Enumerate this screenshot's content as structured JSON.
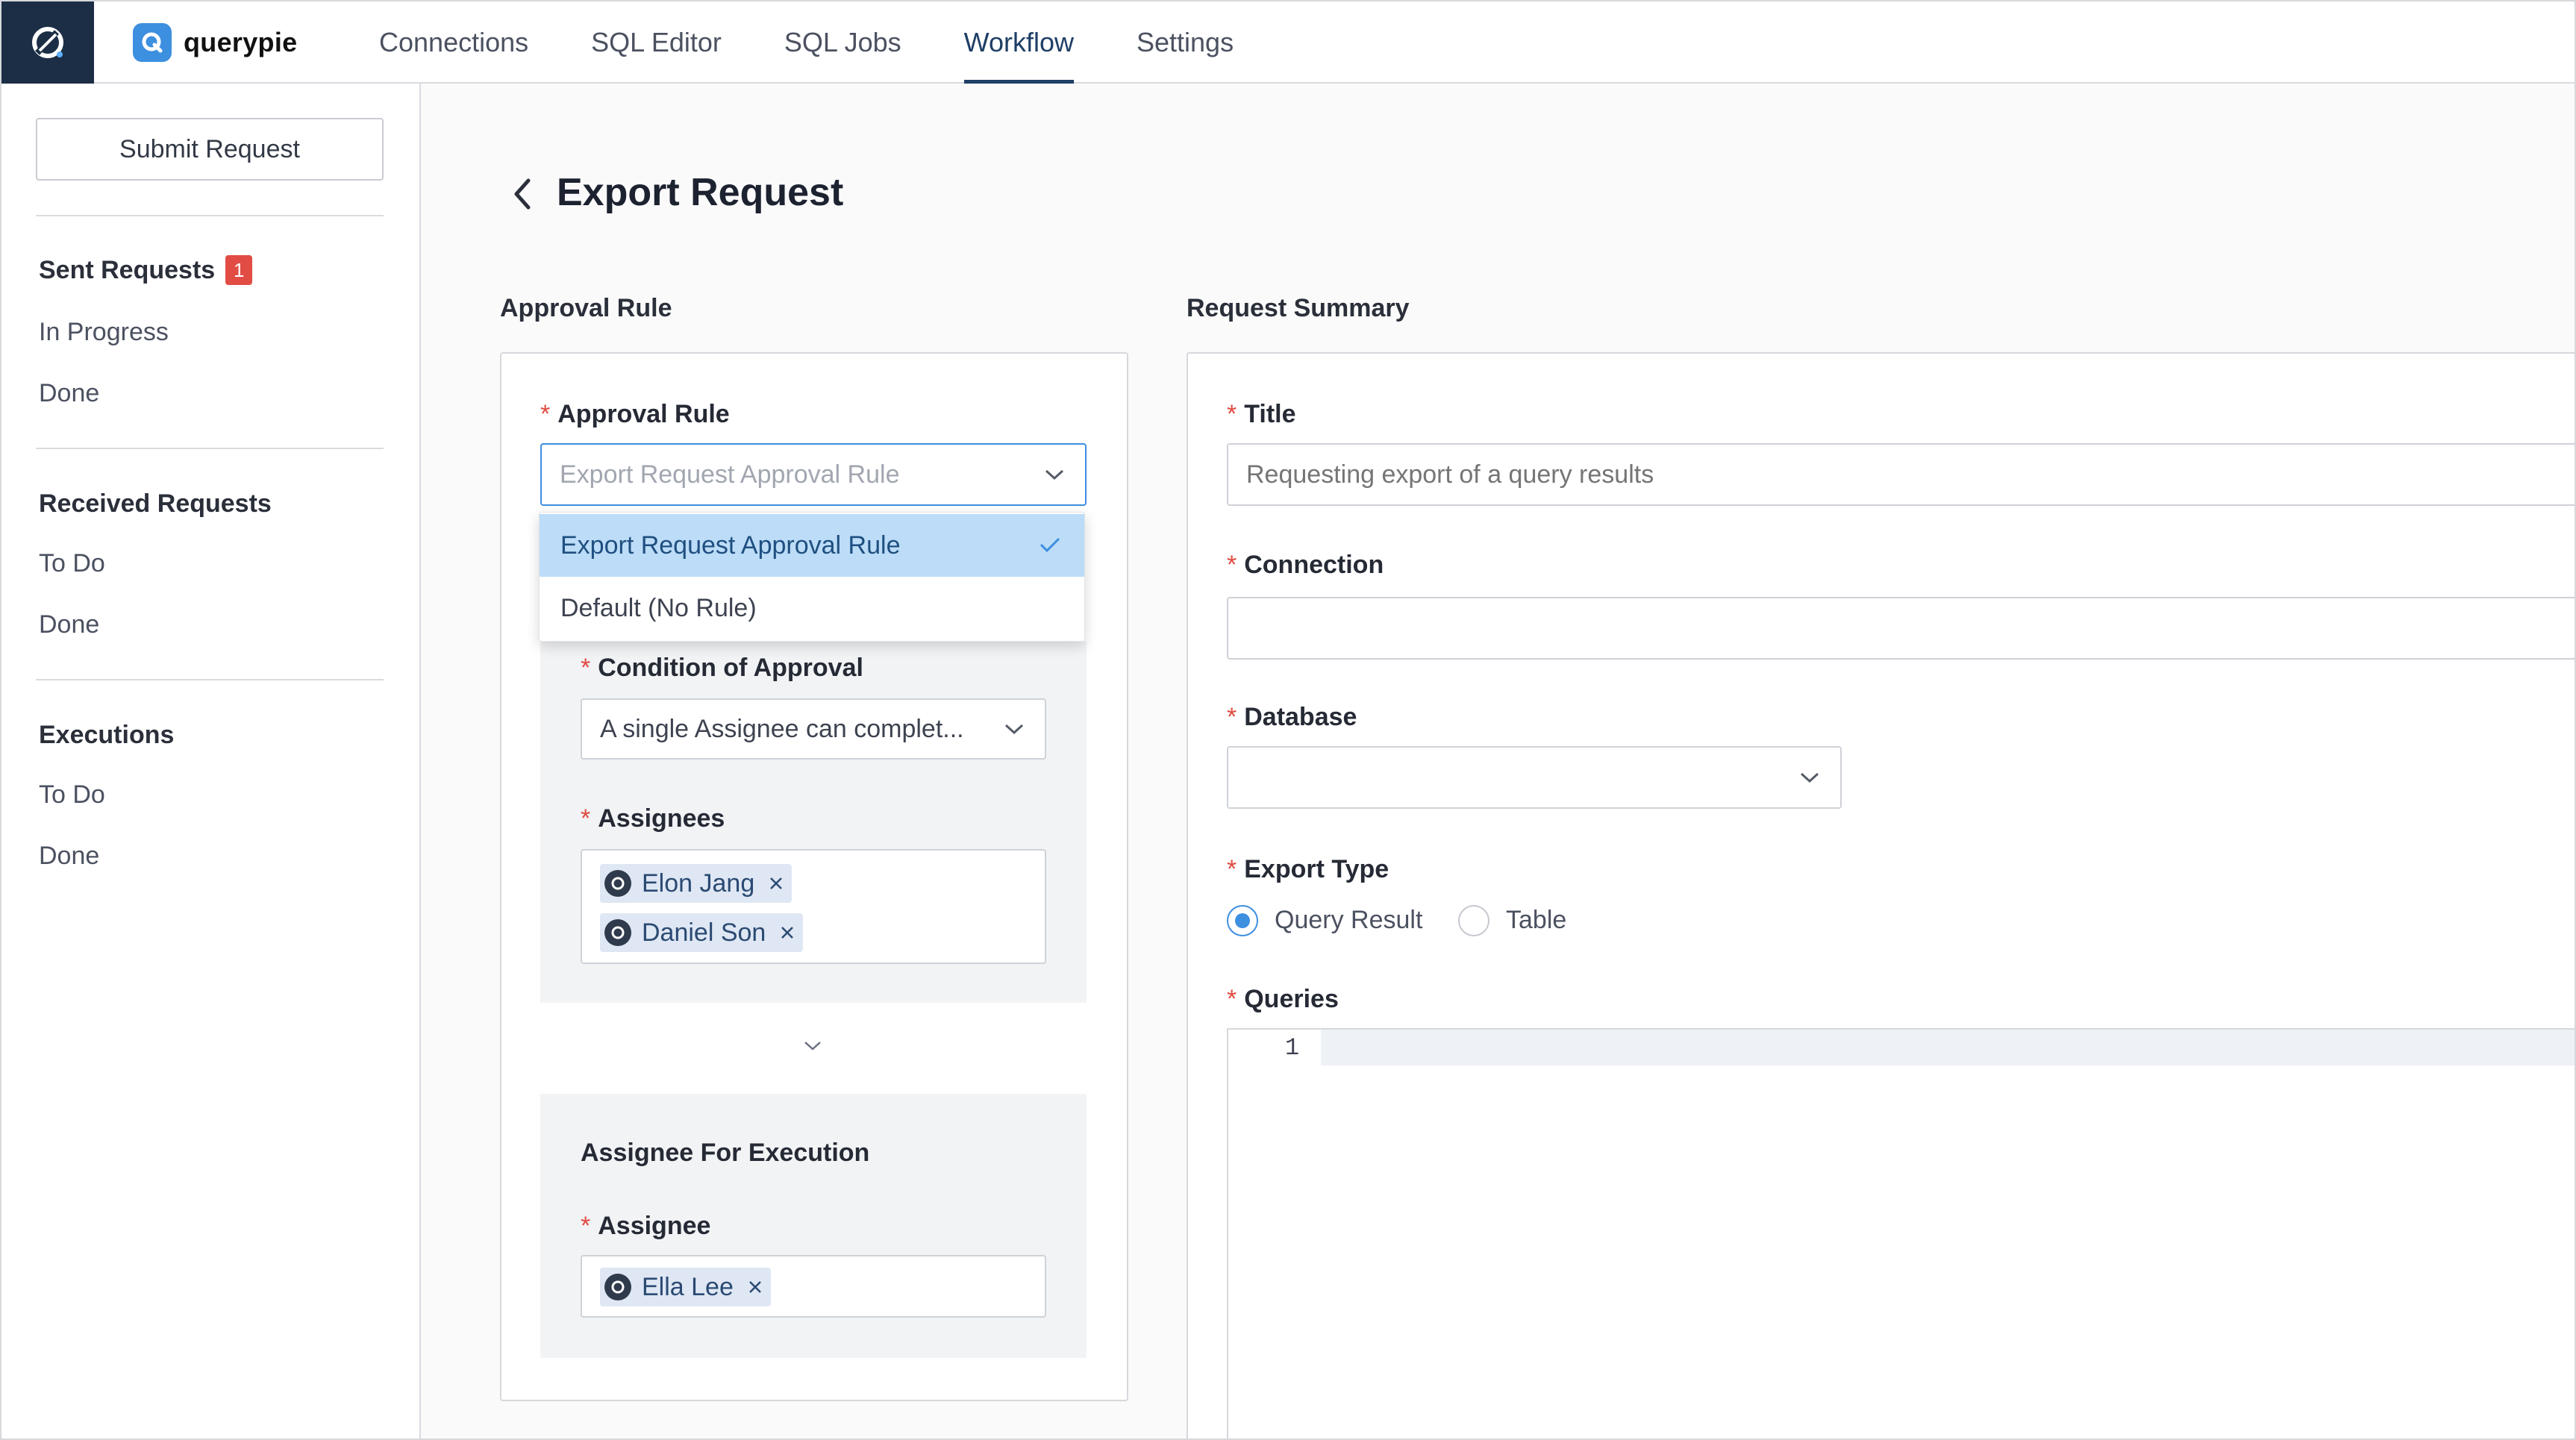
{
  "app": {
    "brand_name": "querypie",
    "brand_letter": "Q"
  },
  "nav": {
    "items": [
      "Connections",
      "SQL Editor",
      "SQL Jobs",
      "Workflow",
      "Settings"
    ],
    "active": "Workflow"
  },
  "sidebar": {
    "submit_label": "Submit Request",
    "sent": {
      "title": "Sent Requests",
      "badge": "1",
      "items": [
        "In Progress",
        "Done"
      ]
    },
    "received": {
      "title": "Received Requests",
      "items": [
        "To Do",
        "Done"
      ]
    },
    "executions": {
      "title": "Executions",
      "items": [
        "To Do",
        "Done"
      ]
    }
  },
  "page": {
    "title": "Export Request",
    "left_section": "Approval Rule",
    "right_section": "Request Summary"
  },
  "approval": {
    "rule_label": "Approval Rule",
    "rule_value": "Export Request Approval Rule",
    "dropdown_options": [
      "Export Request Approval Rule",
      "Default (No Rule)"
    ],
    "condition_label": "Condition of Approval",
    "condition_value": "A single Assignee can complet...",
    "assignees_label": "Assignees",
    "assignees": [
      "Elon Jang",
      "Daniel Son"
    ],
    "execution_title": "Assignee For Execution",
    "execution_label": "Assignee",
    "execution_assignee": "Ella Lee"
  },
  "summary": {
    "title_label": "Title",
    "title_placeholder": "Requesting export of a query results",
    "connection_label": "Connection",
    "database_label": "Database",
    "export_type_label": "Export Type",
    "export_options": [
      "Query Result",
      "Table"
    ],
    "export_selected": "Query Result",
    "queries_label": "Queries",
    "line_number": "1"
  },
  "colors": {
    "accent": "#3d8fe0",
    "nav_active": "#1e3f66",
    "badge": "#e14d45",
    "corner": "#1b2e45",
    "required": "#e04a3f"
  },
  "icons": [
    "app-logo-icon",
    "brand-q-icon",
    "chevron-left-icon",
    "chevron-down-icon",
    "check-icon",
    "avatar-icon",
    "close-icon"
  ]
}
